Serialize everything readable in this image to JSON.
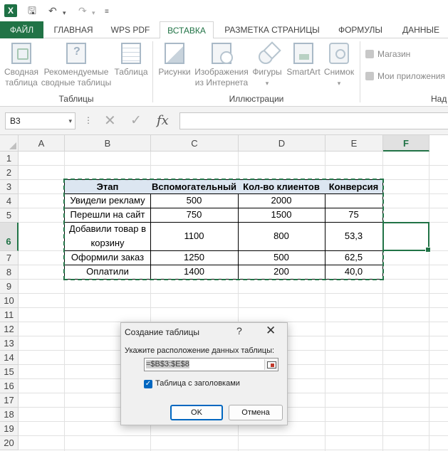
{
  "app": {
    "logo": "X"
  },
  "qat": {
    "save_icon": "save-icon",
    "undo_icon": "undo-icon",
    "redo_icon": "redo-icon",
    "more_icon": "customize-icon"
  },
  "tabs": [
    {
      "label": "ФАЙЛ"
    },
    {
      "label": "ГЛАВНАЯ"
    },
    {
      "label": "WPS PDF"
    },
    {
      "label": "ВСТАВКА"
    },
    {
      "label": "РАЗМЕТКА СТРАНИЦЫ"
    },
    {
      "label": "ФОРМУЛЫ"
    },
    {
      "label": "ДАННЫЕ"
    }
  ],
  "ribbon": {
    "pivot": {
      "line1": "Сводная",
      "line2": "таблица"
    },
    "recommended": {
      "line1": "Рекомендуемые",
      "line2": "сводные таблицы"
    },
    "table": {
      "line1": "Таблица"
    },
    "pictures": {
      "line1": "Рисунки"
    },
    "online": {
      "line1": "Изображения",
      "line2": "из Интернета"
    },
    "shapes": {
      "line1": "Фигуры"
    },
    "smartart": {
      "line1": "SmartArt"
    },
    "screenshot": {
      "line1": "Снимок"
    },
    "store": "Магазин",
    "myapps": "Мои приложения",
    "group_tables": "Таблицы",
    "group_illustrations": "Иллюстрации",
    "group_addins": "Над"
  },
  "formula_bar": {
    "namebox": "B3",
    "dots": "⋮",
    "cancel": "✕",
    "enter": "✓",
    "fx": "fx"
  },
  "columns": [
    "A",
    "B",
    "C",
    "D",
    "E",
    "F"
  ],
  "rows": [
    "1",
    "2",
    "3",
    "4",
    "5",
    "6",
    "7",
    "8",
    "9",
    "10",
    "11",
    "12",
    "13",
    "14",
    "15",
    "16",
    "17",
    "18",
    "19",
    "20"
  ],
  "table": {
    "headers": [
      "Этап",
      "Вспомогательный",
      "Кол-во клиентов",
      "Конверсия"
    ],
    "rows": [
      [
        "Увидели рекламу",
        "500",
        "2000",
        ""
      ],
      [
        "Перешли на сайт",
        "750",
        "1500",
        "75"
      ],
      [
        "Добавили товар в корзину",
        "1100",
        "800",
        "53,3"
      ],
      [
        "Оформили заказ",
        "1250",
        "500",
        "62,5"
      ],
      [
        "Оплатили",
        "1400",
        "200",
        "40,0"
      ]
    ]
  },
  "dialog": {
    "title": "Создание таблицы",
    "help": "?",
    "close": "✕",
    "prompt": "Укажите расположение данных таблицы:",
    "range": "=$B$3:$E$8",
    "has_headers_label": "Таблица с заголовками",
    "has_headers_checked": "✓",
    "ok": "OK",
    "cancel": "Отмена"
  },
  "colors": {
    "accent": "#217346",
    "header_fill": "#dce6f1",
    "checkbox": "#0067c0"
  }
}
